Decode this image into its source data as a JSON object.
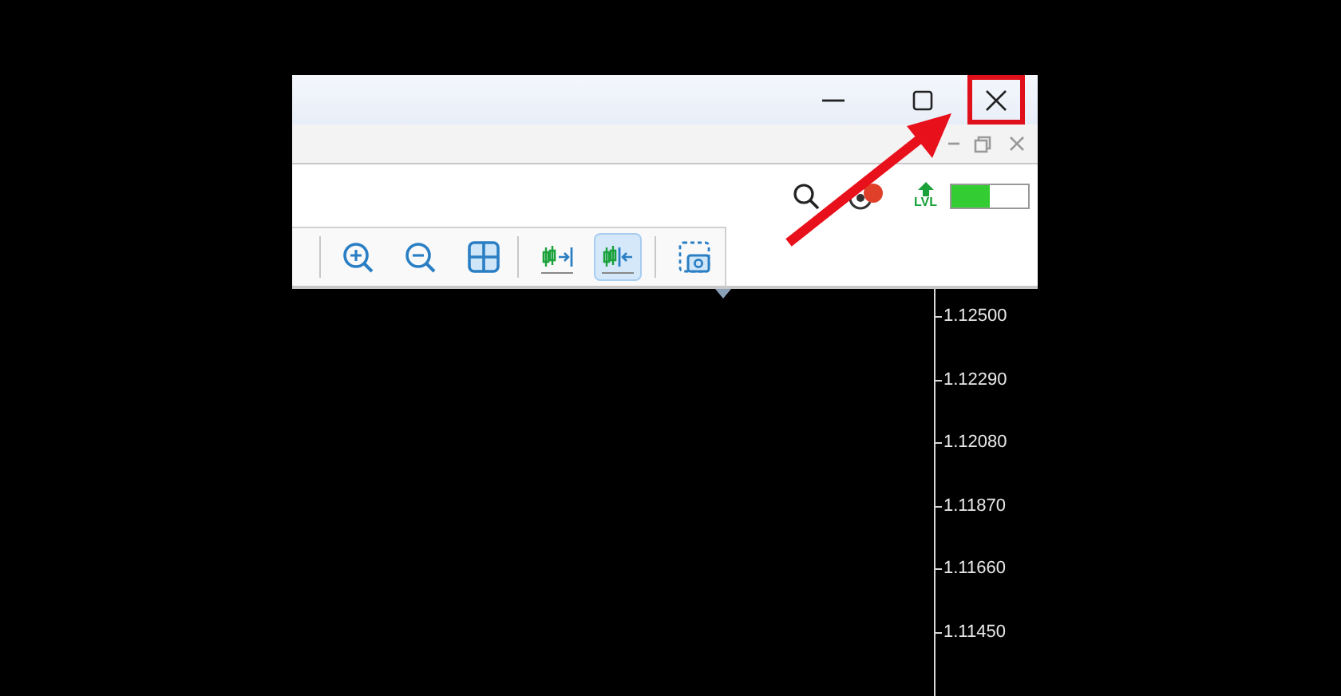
{
  "window": {
    "controls": [
      {
        "kind": "minimize",
        "highlighted": false
      },
      {
        "kind": "maximize",
        "highlighted": false
      },
      {
        "kind": "close",
        "highlighted": true
      }
    ]
  },
  "child_controls": [
    {
      "kind": "minimize"
    },
    {
      "kind": "restore"
    },
    {
      "kind": "close"
    }
  ],
  "top_toolbar": {
    "signal_meter": {
      "level": 0.5
    },
    "lvl_label": "LVL"
  },
  "chart_toolbar": [
    {
      "kind": "zoom_in",
      "selected": false
    },
    {
      "kind": "zoom_out",
      "selected": false
    },
    {
      "kind": "tile",
      "selected": false
    },
    {
      "kind": "divider"
    },
    {
      "kind": "chart_shift",
      "selected": false
    },
    {
      "kind": "auto_scroll",
      "selected": true
    },
    {
      "kind": "divider"
    },
    {
      "kind": "screenshot",
      "selected": false
    }
  ],
  "price_axis": {
    "labels": [
      "1.12500",
      "1.12290",
      "1.12080",
      "1.11870",
      "1.11660",
      "1.11450"
    ]
  },
  "annotation": {
    "kind": "arrow"
  }
}
